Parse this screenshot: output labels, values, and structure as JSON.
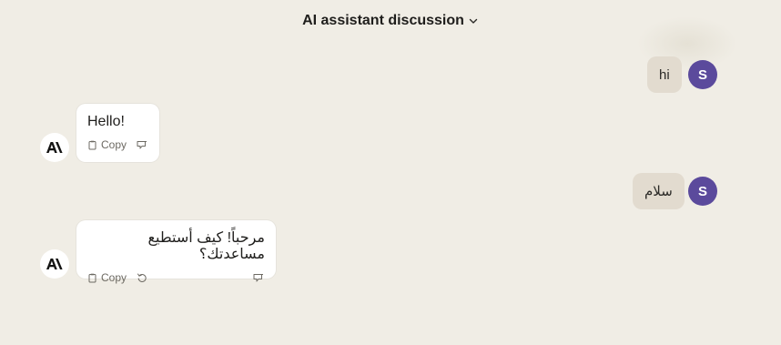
{
  "header": {
    "title": "AI assistant discussion"
  },
  "messages": [
    {
      "role": "user",
      "text": "hi",
      "avatar": "S"
    },
    {
      "role": "assistant",
      "text": "Hello!",
      "copy_label": "Copy"
    },
    {
      "role": "user",
      "text": "سلام",
      "avatar": "S"
    },
    {
      "role": "assistant",
      "text": "مرحباً! كيف أستطيع مساعدتك؟",
      "copy_label": "Copy"
    }
  ],
  "colors": {
    "background": "#f0ede5",
    "user_bubble": "#e2dbcf",
    "avatar": "#5b4a9c",
    "assistant_bubble": "#ffffff"
  },
  "icons": [
    "chevron-down-icon",
    "copy-icon",
    "thumbs-down-icon",
    "retry-icon",
    "anthropic-logo-icon"
  ]
}
